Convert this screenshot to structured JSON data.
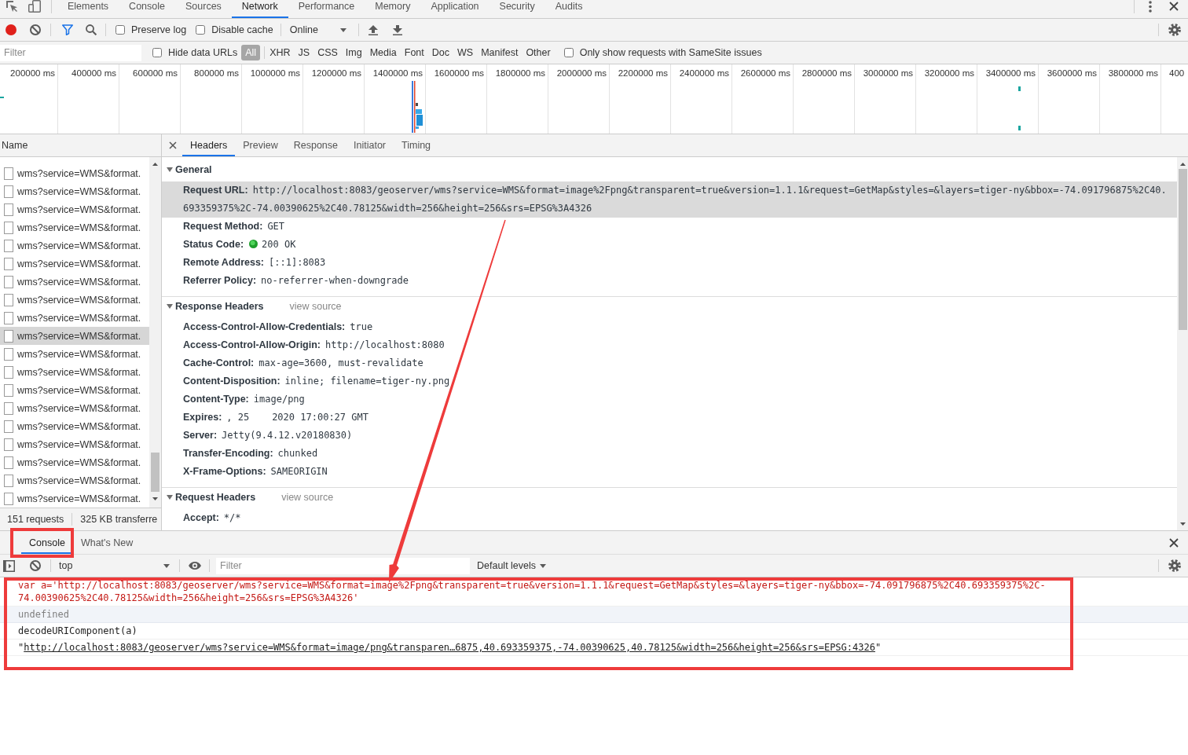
{
  "main_tabs": [
    {
      "label": "Elements",
      "selected": false
    },
    {
      "label": "Console",
      "selected": false
    },
    {
      "label": "Sources",
      "selected": false
    },
    {
      "label": "Network",
      "selected": true
    },
    {
      "label": "Performance",
      "selected": false
    },
    {
      "label": "Memory",
      "selected": false
    },
    {
      "label": "Application",
      "selected": false
    },
    {
      "label": "Security",
      "selected": false
    },
    {
      "label": "Audits",
      "selected": false
    }
  ],
  "toolbar": {
    "recording": true,
    "filter_active": true,
    "options": [
      {
        "label": "Preserve log",
        "checked": false
      },
      {
        "label": "Disable cache",
        "checked": false
      }
    ],
    "throttling": "Online"
  },
  "filter_bar": {
    "placeholder": "Filter",
    "hide_data_urls": {
      "label": "Hide data URLs",
      "checked": false
    },
    "types": [
      {
        "label": "All",
        "selected": true
      },
      {
        "label": "XHR",
        "selected": false
      },
      {
        "label": "JS",
        "selected": false
      },
      {
        "label": "CSS",
        "selected": false
      },
      {
        "label": "Img",
        "selected": false
      },
      {
        "label": "Media",
        "selected": false
      },
      {
        "label": "Font",
        "selected": false
      },
      {
        "label": "Doc",
        "selected": false
      },
      {
        "label": "WS",
        "selected": false
      },
      {
        "label": "Manifest",
        "selected": false
      },
      {
        "label": "Other",
        "selected": false
      }
    ],
    "samesite": {
      "label": "Only show requests with SameSite issues",
      "checked": false
    }
  },
  "timeline": {
    "ticks": [
      "200000 ms",
      "400000 ms",
      "600000 ms",
      "800000 ms",
      "1000000 ms",
      "1200000 ms",
      "1400000 ms",
      "1600000 ms",
      "1800000 ms",
      "2000000 ms",
      "2200000 ms",
      "2400000 ms",
      "2600000 ms",
      "2800000 ms",
      "3000000 ms",
      "3200000 ms",
      "3400000 ms",
      "3600000 ms",
      "3800000 ms",
      "400"
    ]
  },
  "requests": {
    "column": "Name",
    "rows": [
      {
        "name": "wms?service=WMS&format.",
        "selected": false
      },
      {
        "name": "wms?service=WMS&format.",
        "selected": false
      },
      {
        "name": "wms?service=WMS&format.",
        "selected": false
      },
      {
        "name": "wms?service=WMS&format.",
        "selected": false
      },
      {
        "name": "wms?service=WMS&format.",
        "selected": false
      },
      {
        "name": "wms?service=WMS&format.",
        "selected": false
      },
      {
        "name": "wms?service=WMS&format.",
        "selected": false
      },
      {
        "name": "wms?service=WMS&format.",
        "selected": false
      },
      {
        "name": "wms?service=WMS&format.",
        "selected": false
      },
      {
        "name": "wms?service=WMS&format.",
        "selected": true
      },
      {
        "name": "wms?service=WMS&format.",
        "selected": false
      },
      {
        "name": "wms?service=WMS&format.",
        "selected": false
      },
      {
        "name": "wms?service=WMS&format.",
        "selected": false
      },
      {
        "name": "wms?service=WMS&format.",
        "selected": false
      },
      {
        "name": "wms?service=WMS&format.",
        "selected": false
      },
      {
        "name": "wms?service=WMS&format.",
        "selected": false
      },
      {
        "name": "wms?service=WMS&format.",
        "selected": false
      },
      {
        "name": "wms?service=WMS&format.",
        "selected": false
      },
      {
        "name": "wms?service=WMS&format.",
        "selected": false
      }
    ],
    "summary": [
      "151 requests",
      "325 KB transferre"
    ]
  },
  "details": {
    "tabs": [
      {
        "label": "Headers",
        "selected": true
      },
      {
        "label": "Preview",
        "selected": false
      },
      {
        "label": "Response",
        "selected": false
      },
      {
        "label": "Initiator",
        "selected": false
      },
      {
        "label": "Timing",
        "selected": false
      }
    ],
    "sections": [
      {
        "title": "General",
        "expanded": true,
        "rows": [
          {
            "kind": "text",
            "key": "Request URL:",
            "value": "http://localhost:8083/geoserver/wms?service=WMS&format=image%2Fpng&transparent=true&version=1.1.1&request=GetMap&styles=&layers=tiger-ny&bbox=-74.091796875%2C40.693359375%2C-74.00390625%2C40.78125&width=256&height=256&srs=EPSG%3A4326",
            "highlighted": true
          },
          {
            "kind": "text",
            "key": "Request Method:",
            "value": "GET",
            "highlighted": false
          },
          {
            "kind": "status",
            "key": "Status Code:",
            "value": "200 OK",
            "highlighted": false
          },
          {
            "kind": "text",
            "key": "Remote Address:",
            "value": "[::1]:8083",
            "highlighted": false
          },
          {
            "kind": "text",
            "key": "Referrer Policy:",
            "value": "no-referrer-when-downgrade",
            "highlighted": false
          }
        ]
      },
      {
        "title": "Response Headers",
        "link": "view source",
        "expanded": true,
        "rows": [
          {
            "kind": "text",
            "key": "Access-Control-Allow-Credentials:",
            "value": "true",
            "highlighted": false
          },
          {
            "kind": "text",
            "key": "Access-Control-Allow-Origin:",
            "value": "http://localhost:8080",
            "highlighted": false
          },
          {
            "kind": "text",
            "key": "Cache-Control:",
            "value": "max-age=3600, must-revalidate",
            "highlighted": false
          },
          {
            "kind": "text",
            "key": "Content-Disposition:",
            "value": "inline; filename=tiger-ny.png",
            "highlighted": false
          },
          {
            "kind": "text",
            "key": "Content-Type:",
            "value": "image/png",
            "highlighted": false
          },
          {
            "kind": "text",
            "key": "Expires:",
            "value": ", 25    2020 17:00:27 GMT",
            "highlighted": false
          },
          {
            "kind": "text",
            "key": "Server:",
            "value": "Jetty(9.4.12.v20180830)",
            "highlighted": false
          },
          {
            "kind": "text",
            "key": "Transfer-Encoding:",
            "value": "chunked",
            "highlighted": false
          },
          {
            "kind": "text",
            "key": "X-Frame-Options:",
            "value": "SAMEORIGIN",
            "highlighted": false
          }
        ]
      },
      {
        "title": "Request Headers",
        "link": "view source",
        "expanded": true,
        "rows": [
          {
            "kind": "text",
            "key": "Accept:",
            "value": "*/*",
            "highlighted": false
          }
        ]
      }
    ]
  },
  "drawer": {
    "tabs": [
      {
        "label": "Console",
        "selected": true
      },
      {
        "label": "What's New",
        "selected": false
      }
    ],
    "context": "top",
    "filter_placeholder": "Filter",
    "levels": "Default levels",
    "messages": [
      {
        "kind": "code",
        "text": "var a='http://localhost:8083/geoserver/wms?service=WMS&format=image%2Fpng&transparent=true&version=1.1.1&request=GetMap&styles=&layers=tiger-ny&bbox=-74.091796875%2C40.693359375%2C-74.00390625%2C40.78125&width=256&height=256&srs=EPSG%3A4326'"
      },
      {
        "kind": "value",
        "text": "undefined"
      },
      {
        "kind": "command",
        "text": "decodeURIComponent(a)"
      },
      {
        "kind": "link",
        "prefix": "\"",
        "text": "http://localhost:8083/geoserver/wms?service=WMS&format=image/png&transparen…6875,40.693359375,-74.00390625,40.78125&width=256&height=256&srs=EPSG:4326",
        "suffix": "\""
      }
    ]
  }
}
